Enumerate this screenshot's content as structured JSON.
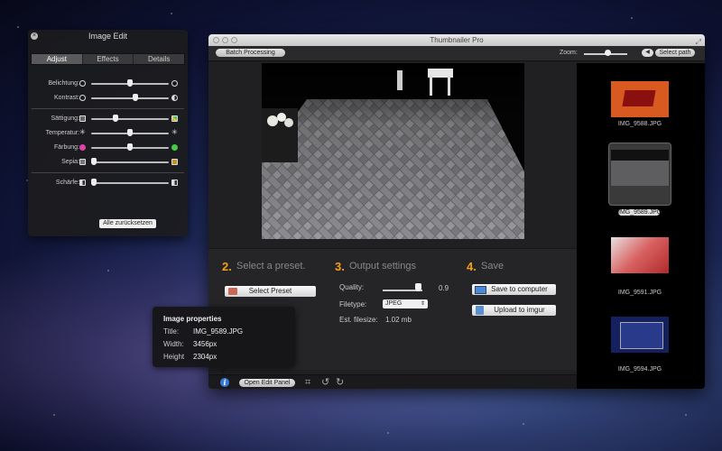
{
  "image_edit": {
    "title": "Image Edit",
    "tabs": [
      "Adjust",
      "Effects",
      "Details"
    ],
    "sliders": [
      {
        "label": "Belichtung:",
        "value": 0.5
      },
      {
        "label": "Kontrast:",
        "value": 0.58
      },
      {
        "label": "Sättigung:",
        "value": 0.3
      },
      {
        "label": "Temperatur:",
        "value": 0.5
      },
      {
        "label": "Färbung:",
        "value": 0.5
      },
      {
        "label": "Sepia:",
        "value": 0.0
      },
      {
        "label": "Schärfe:",
        "value": 0.0
      }
    ],
    "reset_label": "Alle zurücksetzen"
  },
  "window": {
    "title": "Thumbnailer Pro",
    "batch_label": "Batch Processing",
    "zoom_label": "Zoom:",
    "zoom_value": 0.55,
    "select_path_label": "Select path"
  },
  "thumbnails": [
    {
      "name": "IMG_9588.JPG"
    },
    {
      "name": "IMG_9589.JPG"
    },
    {
      "name": "IMG_9591.JPG"
    },
    {
      "name": "IMG_9594.JPG"
    }
  ],
  "steps": {
    "s2": {
      "num": "2.",
      "text": "Select a preset.",
      "button": "Select Preset"
    },
    "s3": {
      "num": "3.",
      "text": "Output settings",
      "quality_label": "Quality:",
      "quality_value": "0.9",
      "filetype_label": "Filetype:",
      "filetype_value": "JPEG",
      "filesize_label": "Est. filesize:",
      "filesize_value": "1.02 mb"
    },
    "s4": {
      "num": "4.",
      "text": "Save",
      "save_label": "Save to computer",
      "upload_label": "Upload to imgur"
    }
  },
  "bottom": {
    "open_edit_label": "Open Edit Panel"
  },
  "properties": {
    "title": "Image properties",
    "rows": [
      {
        "key": "Title:",
        "value": "IMG_9589.JPG"
      },
      {
        "key": "Width:",
        "value": "3456px"
      },
      {
        "key": "Height",
        "value": "2304px"
      }
    ]
  }
}
